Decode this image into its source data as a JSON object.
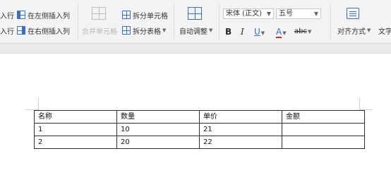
{
  "ribbon": {
    "row_insert_above_partial": "入行",
    "row_insert_below_partial": "入行",
    "insert_col_left": "在左侧插入列",
    "insert_col_right": "在右侧插入列",
    "merge_cells": "合并单元格",
    "split_cells": "拆分单元格",
    "split_table": "拆分表格",
    "autofit": "自动调整",
    "font_name": "宋体 (正文)",
    "font_size": "五号",
    "bold": "B",
    "italic": "I",
    "underline": "U",
    "font_color": "A",
    "highlight": "abc",
    "align": "对齐方式",
    "text_dir_partial": "文字"
  },
  "table": {
    "rows": [
      [
        "名称",
        "数量",
        "单价",
        "金额"
      ],
      [
        "1",
        "10",
        "21",
        ""
      ],
      [
        "2",
        "20",
        "22",
        ""
      ]
    ]
  }
}
